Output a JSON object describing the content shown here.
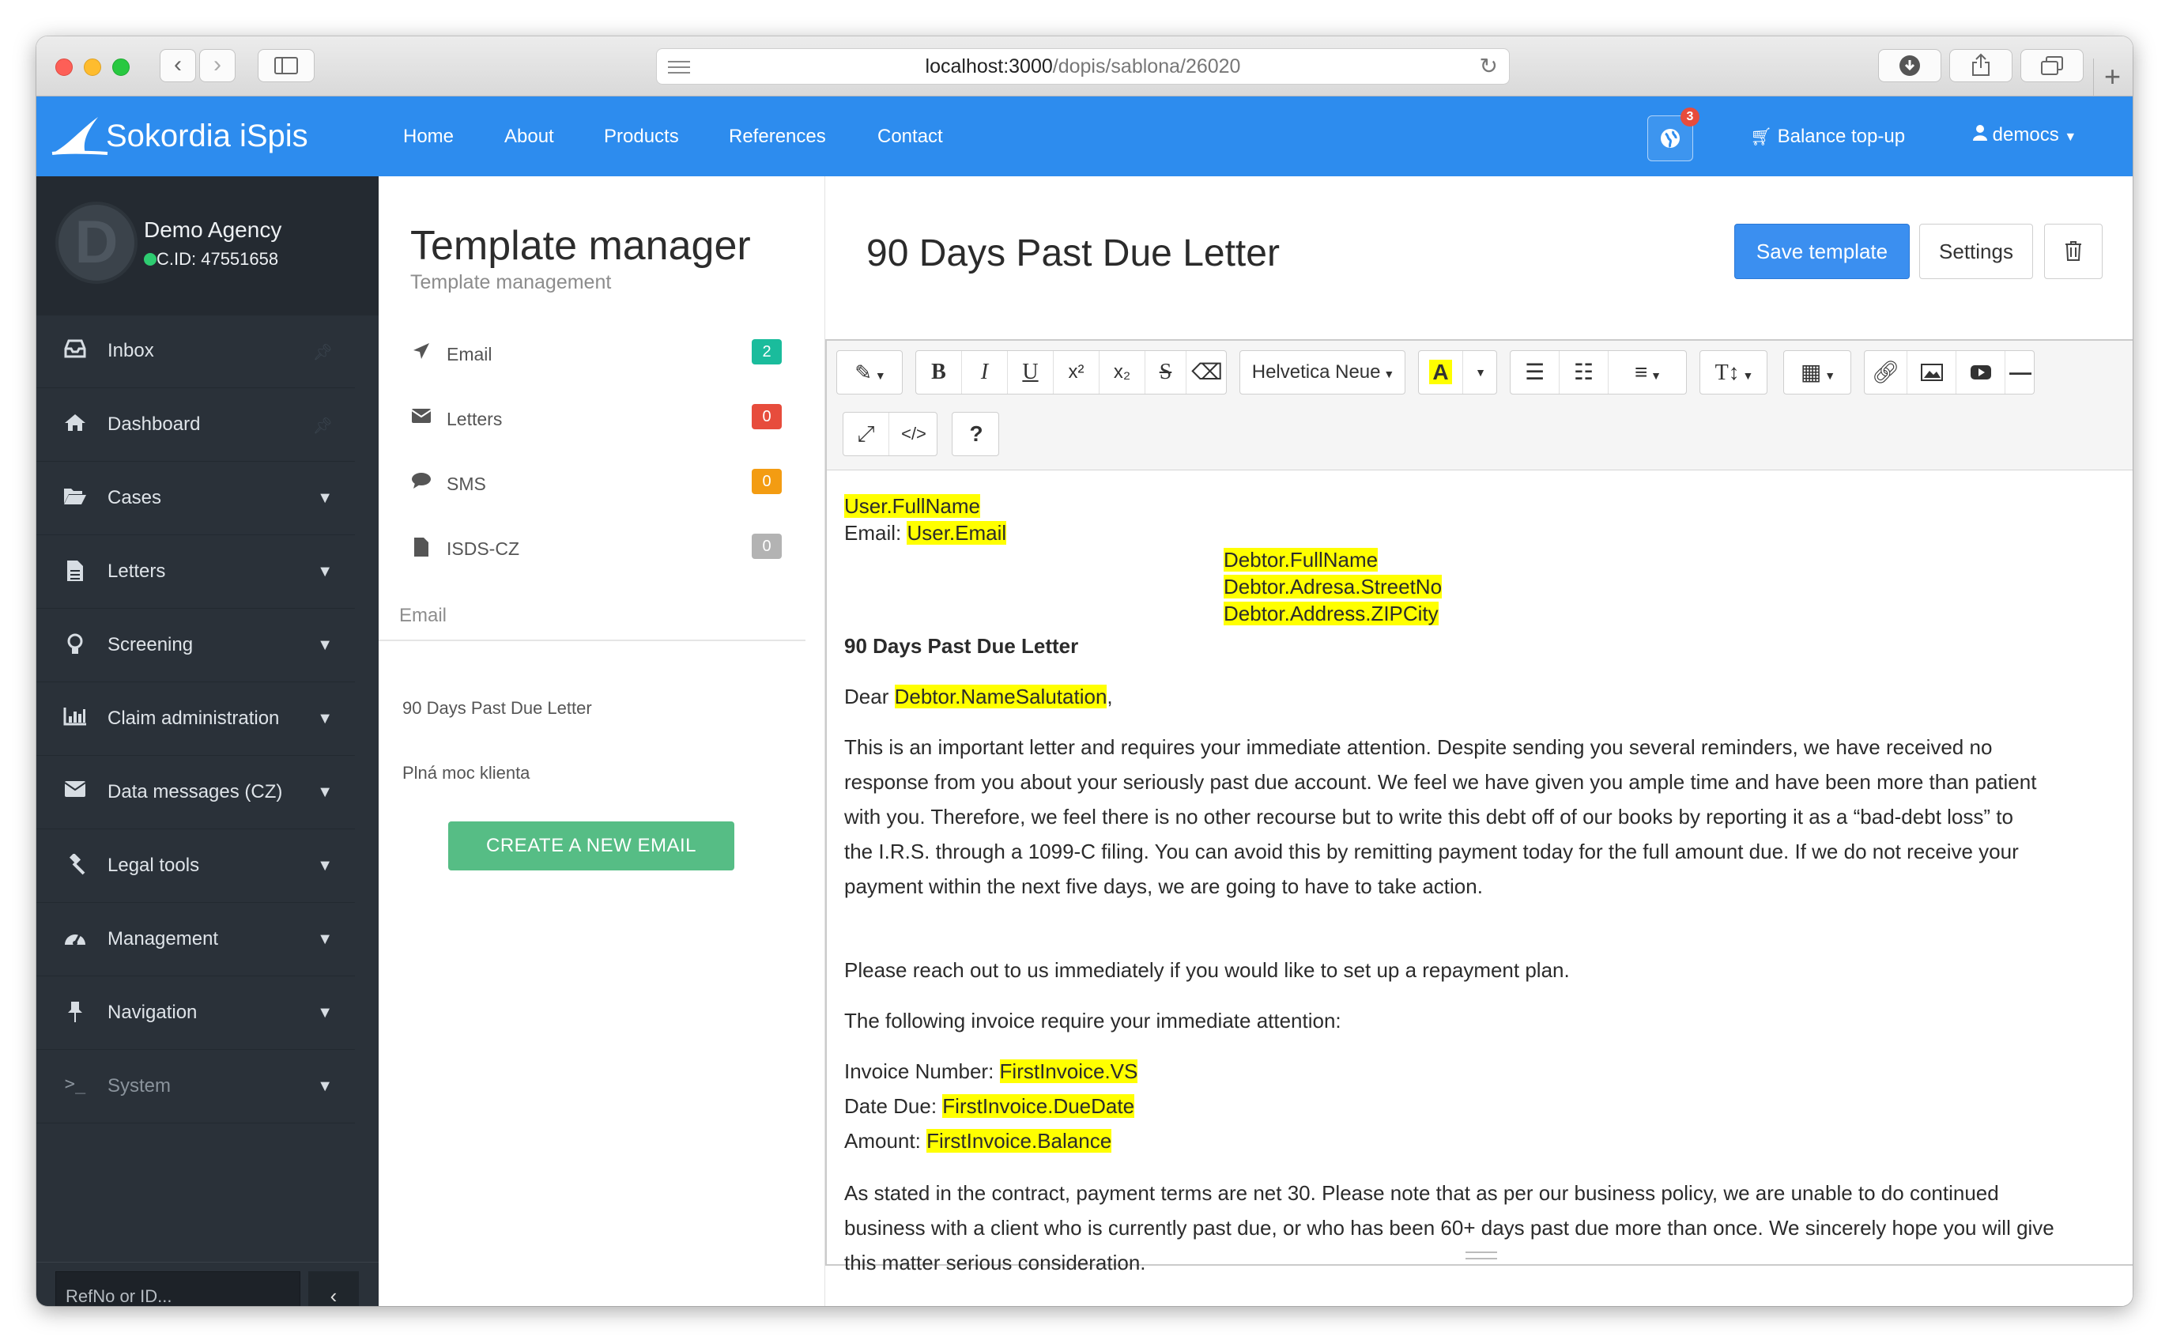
{
  "browser": {
    "url_host": "localhost:3000",
    "url_path": "/dopis/sablona/26020"
  },
  "header": {
    "brand": "Sokordia iSpis",
    "nav": [
      "Home",
      "About",
      "Products",
      "References",
      "Contact"
    ],
    "notification_count": "3",
    "balance_label": "Balance top-up",
    "user_label": "democs"
  },
  "sidebar": {
    "avatar_letter": "D",
    "agency": "Demo Agency",
    "cid": "C.ID: 47551658",
    "items": [
      {
        "label": "Inbox",
        "icon": "inbox-icon"
      },
      {
        "label": "Dashboard",
        "icon": "home-icon"
      },
      {
        "label": "Cases",
        "icon": "folder-open-icon"
      },
      {
        "label": "Letters",
        "icon": "file-text-icon"
      },
      {
        "label": "Screening",
        "icon": "lightbulb-icon"
      },
      {
        "label": "Claim administration",
        "icon": "bar-chart-icon"
      },
      {
        "label": "Data messages (CZ)",
        "icon": "envelope-icon"
      },
      {
        "label": "Legal tools",
        "icon": "gavel-icon"
      },
      {
        "label": "Management",
        "icon": "dashboard-icon"
      },
      {
        "label": "Navigation",
        "icon": "pin-icon"
      },
      {
        "label": "System",
        "icon": "terminal-icon"
      }
    ],
    "search_placeholder": "RefNo or ID...",
    "collapse_glyph": "‹"
  },
  "template_manager": {
    "title": "Template manager",
    "subtitle": "Template management",
    "categories": [
      {
        "label": "Email",
        "count": "2",
        "color": "#1abc9c"
      },
      {
        "label": "Letters",
        "count": "0",
        "color": "#e74c3c"
      },
      {
        "label": "SMS",
        "count": "0",
        "color": "#f39c12"
      },
      {
        "label": "ISDS-CZ",
        "count": "0",
        "color": "#b3b3b3"
      }
    ],
    "section_label": "Email",
    "templates": [
      "90 Days Past Due Letter",
      "Plná moc klienta"
    ],
    "create_label": "CREATE A NEW EMAIL"
  },
  "editor": {
    "document_title": "90 Days Past Due Letter",
    "save_label": "Save template",
    "settings_label": "Settings",
    "font_name": "Helvetica Neue",
    "content": {
      "user_fullname": "User.FullName",
      "email_prefix": "Email: ",
      "user_email": "User.Email",
      "debtor_fullname": "Debtor.FullName",
      "debtor_street": "Debtor.Adresa.StreetNo",
      "debtor_zipcity": "Debtor.Address.ZIPCity",
      "heading": "90 Days Past Due Letter",
      "dear": "Dear ",
      "salutation": "Debtor.NameSalutation",
      "comma": ",",
      "paragraph1_lines": [
        "This is an important letter and requires your immediate attention. Despite sending you several reminders, we have received no",
        "response from you about your seriously past due account. We feel we have given you ample time and have been more than patient",
        "with you. Therefore, we feel there is no other recourse but to write this debt off of our books by reporting it as a “bad-debt loss” to",
        "the I.R.S. through a 1099-C filing. You can avoid this by remitting payment today for the full amount due. If we do not receive your",
        "payment within the next five days, we are going to have to take action."
      ],
      "paragraph2": "Please reach out to us immediately if you would like to set up a repayment plan.",
      "paragraph3": "The following invoice require your immediate attention:",
      "invoice_number_label": "Invoice Number: ",
      "invoice_number_field": "FirstInvoice.VS",
      "due_label": "Date Due: ",
      "due_field": "FirstInvoice.DueDate",
      "amount_label": "Amount: ",
      "amount_field": "FirstInvoice.Balance",
      "paragraph4_lines": [
        "As stated in the contract, payment terms are net 30. Please note that as per our business policy, we are unable to do continued",
        "business with a client who is currently past due, or who has been 60+ days past due more than once. We sincerely hope you will give",
        "this matter serious consideration."
      ]
    }
  },
  "colors": {
    "header_blue": "#2d8cee",
    "sidebar_dark": "#2a3139",
    "highlight": "#ffff00",
    "create_green": "#56bd85"
  }
}
